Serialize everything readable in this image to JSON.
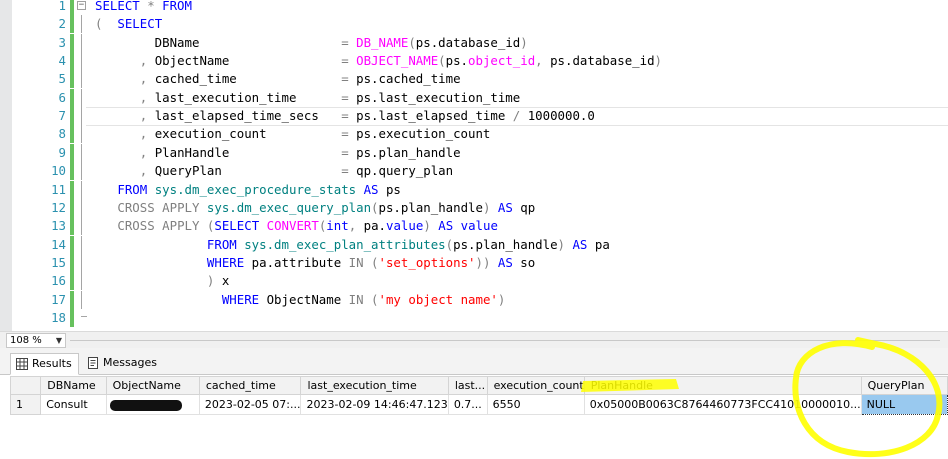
{
  "editor": {
    "lines": [
      {
        "n": "1",
        "tokens": [
          [
            "kw",
            "SELECT "
          ],
          [
            "gy",
            "* "
          ],
          [
            "kw",
            "FROM"
          ]
        ]
      },
      {
        "n": "2",
        "tokens": [
          [
            "gy",
            "("
          ],
          [
            "",
            "  "
          ],
          [
            "kw",
            "SELECT"
          ]
        ]
      },
      {
        "n": "3",
        "tokens": [
          [
            "",
            "        DBName                   "
          ],
          [
            "gy",
            "= "
          ],
          [
            "fn",
            "DB_NAME"
          ],
          [
            "gy",
            "("
          ],
          [
            "",
            "ps.database_id"
          ],
          [
            "gy",
            ")"
          ]
        ]
      },
      {
        "n": "4",
        "tokens": [
          [
            "",
            "      "
          ],
          [
            "gy",
            ", "
          ],
          [
            "",
            "ObjectName               "
          ],
          [
            "gy",
            "= "
          ],
          [
            "fn",
            "OBJECT_NAME"
          ],
          [
            "gy",
            "("
          ],
          [
            "",
            "ps."
          ],
          [
            "fn",
            "object_id"
          ],
          [
            "gy",
            ", "
          ],
          [
            "",
            "ps.database_id"
          ],
          [
            "gy",
            ")"
          ]
        ]
      },
      {
        "n": "5",
        "tokens": [
          [
            "",
            "      "
          ],
          [
            "gy",
            ", "
          ],
          [
            "",
            "cached_time              "
          ],
          [
            "gy",
            "= "
          ],
          [
            "",
            "ps.cached_time"
          ]
        ]
      },
      {
        "n": "6",
        "tokens": [
          [
            "",
            "      "
          ],
          [
            "gy",
            ", "
          ],
          [
            "",
            "last_execution_time      "
          ],
          [
            "gy",
            "= "
          ],
          [
            "",
            "ps.last_execution_time"
          ]
        ]
      },
      {
        "n": "7",
        "tokens": [
          [
            "",
            "      "
          ],
          [
            "gy",
            ", "
          ],
          [
            "",
            "last_elapsed_time_secs   "
          ],
          [
            "gy",
            "= "
          ],
          [
            "",
            "ps.last_elapsed_time "
          ],
          [
            "gy",
            "/ "
          ],
          [
            "",
            "1000000.0"
          ]
        ]
      },
      {
        "n": "8",
        "tokens": [
          [
            "",
            "      "
          ],
          [
            "gy",
            ", "
          ],
          [
            "",
            "execution_count          "
          ],
          [
            "gy",
            "= "
          ],
          [
            "",
            "ps.execution_count"
          ]
        ]
      },
      {
        "n": "9",
        "tokens": [
          [
            "",
            "      "
          ],
          [
            "gy",
            ", "
          ],
          [
            "",
            "PlanHandle               "
          ],
          [
            "gy",
            "= "
          ],
          [
            "",
            "ps.plan_handle"
          ]
        ]
      },
      {
        "n": "10",
        "tokens": [
          [
            "",
            "      "
          ],
          [
            "gy",
            ", "
          ],
          [
            "",
            "QueryPlan                "
          ],
          [
            "gy",
            "= "
          ],
          [
            "",
            "qp.query_plan"
          ]
        ]
      },
      {
        "n": "11",
        "tokens": [
          [
            "",
            "   "
          ],
          [
            "kw",
            "FROM "
          ],
          [
            "sy",
            "sys.dm_exec_procedure_stats "
          ],
          [
            "kw",
            "AS "
          ],
          [
            "",
            "ps"
          ]
        ]
      },
      {
        "n": "12",
        "tokens": [
          [
            "",
            "   "
          ],
          [
            "gy",
            "CROSS APPLY "
          ],
          [
            "sy",
            "sys.dm_exec_query_plan"
          ],
          [
            "gy",
            "("
          ],
          [
            "",
            "ps.plan_handle"
          ],
          [
            "gy",
            ") "
          ],
          [
            "kw",
            "AS "
          ],
          [
            "",
            "qp"
          ]
        ]
      },
      {
        "n": "13",
        "tokens": [
          [
            "",
            "   "
          ],
          [
            "gy",
            "CROSS APPLY "
          ],
          [
            "gy",
            "("
          ],
          [
            "kw",
            "SELECT "
          ],
          [
            "fn",
            "CONVERT"
          ],
          [
            "gy",
            "("
          ],
          [
            "kw",
            "int"
          ],
          [
            "gy",
            ", "
          ],
          [
            "",
            "pa."
          ],
          [
            "kw",
            "value"
          ],
          [
            "gy",
            ") "
          ],
          [
            "kw",
            "AS "
          ],
          [
            "kw",
            "value"
          ]
        ]
      },
      {
        "n": "14",
        "tokens": [
          [
            "",
            "               "
          ],
          [
            "kw",
            "FROM "
          ],
          [
            "sy",
            "sys.dm_exec_plan_attributes"
          ],
          [
            "gy",
            "("
          ],
          [
            "",
            "ps.plan_handle"
          ],
          [
            "gy",
            ") "
          ],
          [
            "kw",
            "AS "
          ],
          [
            "",
            "pa"
          ]
        ]
      },
      {
        "n": "15",
        "tokens": [
          [
            "",
            "               "
          ],
          [
            "kw",
            "WHERE "
          ],
          [
            "",
            "pa.attribute "
          ],
          [
            "gy",
            "IN "
          ],
          [
            "gy",
            "("
          ],
          [
            "st",
            "'set_options'"
          ],
          [
            "gy",
            ")) "
          ],
          [
            "kw",
            "AS "
          ],
          [
            "",
            "so"
          ]
        ]
      },
      {
        "n": "16",
        "tokens": [
          [
            "",
            "               "
          ],
          [
            "gy",
            ") "
          ],
          [
            "",
            "x"
          ]
        ]
      },
      {
        "n": "17",
        "tokens": [
          [
            "",
            "                 "
          ],
          [
            "kw",
            "WHERE "
          ],
          [
            "",
            "ObjectName "
          ],
          [
            "gy",
            "IN "
          ],
          [
            "gy",
            "("
          ],
          [
            "st",
            "'my object name'"
          ],
          [
            "gy",
            ")"
          ]
        ]
      },
      {
        "n": "18",
        "tokens": []
      }
    ]
  },
  "zoom": {
    "value": "108 %"
  },
  "tabs": [
    {
      "label": "Results",
      "active": true
    },
    {
      "label": "Messages",
      "active": false
    }
  ],
  "grid": {
    "columns": [
      "",
      "DBName",
      "ObjectName",
      "cached_time",
      "last_execution_time",
      "last...",
      "execution_count",
      "PlanHandle",
      "QueryPlan"
    ],
    "rows": [
      [
        "1",
        "Consult",
        "",
        "2023-02-05 07:...",
        "2023-02-09 14:46:47.123",
        "0.7...",
        "6550",
        "0x05000B0063C8764460773FCC41010000010...",
        "NULL"
      ]
    ]
  },
  "colors": {
    "keyword": "#0000ff",
    "function": "#ff00ff",
    "operator": "#808080",
    "string": "#ff0000",
    "system_object": "#008080",
    "line_number": "#2b91af",
    "change_marker": "#67c15e",
    "highlighter": "#ffff00",
    "selected_cell": "#99c9ef"
  },
  "icons": {
    "results_tab": "grid-icon",
    "messages_tab": "messages-icon",
    "collapse": "collapse-icon"
  }
}
